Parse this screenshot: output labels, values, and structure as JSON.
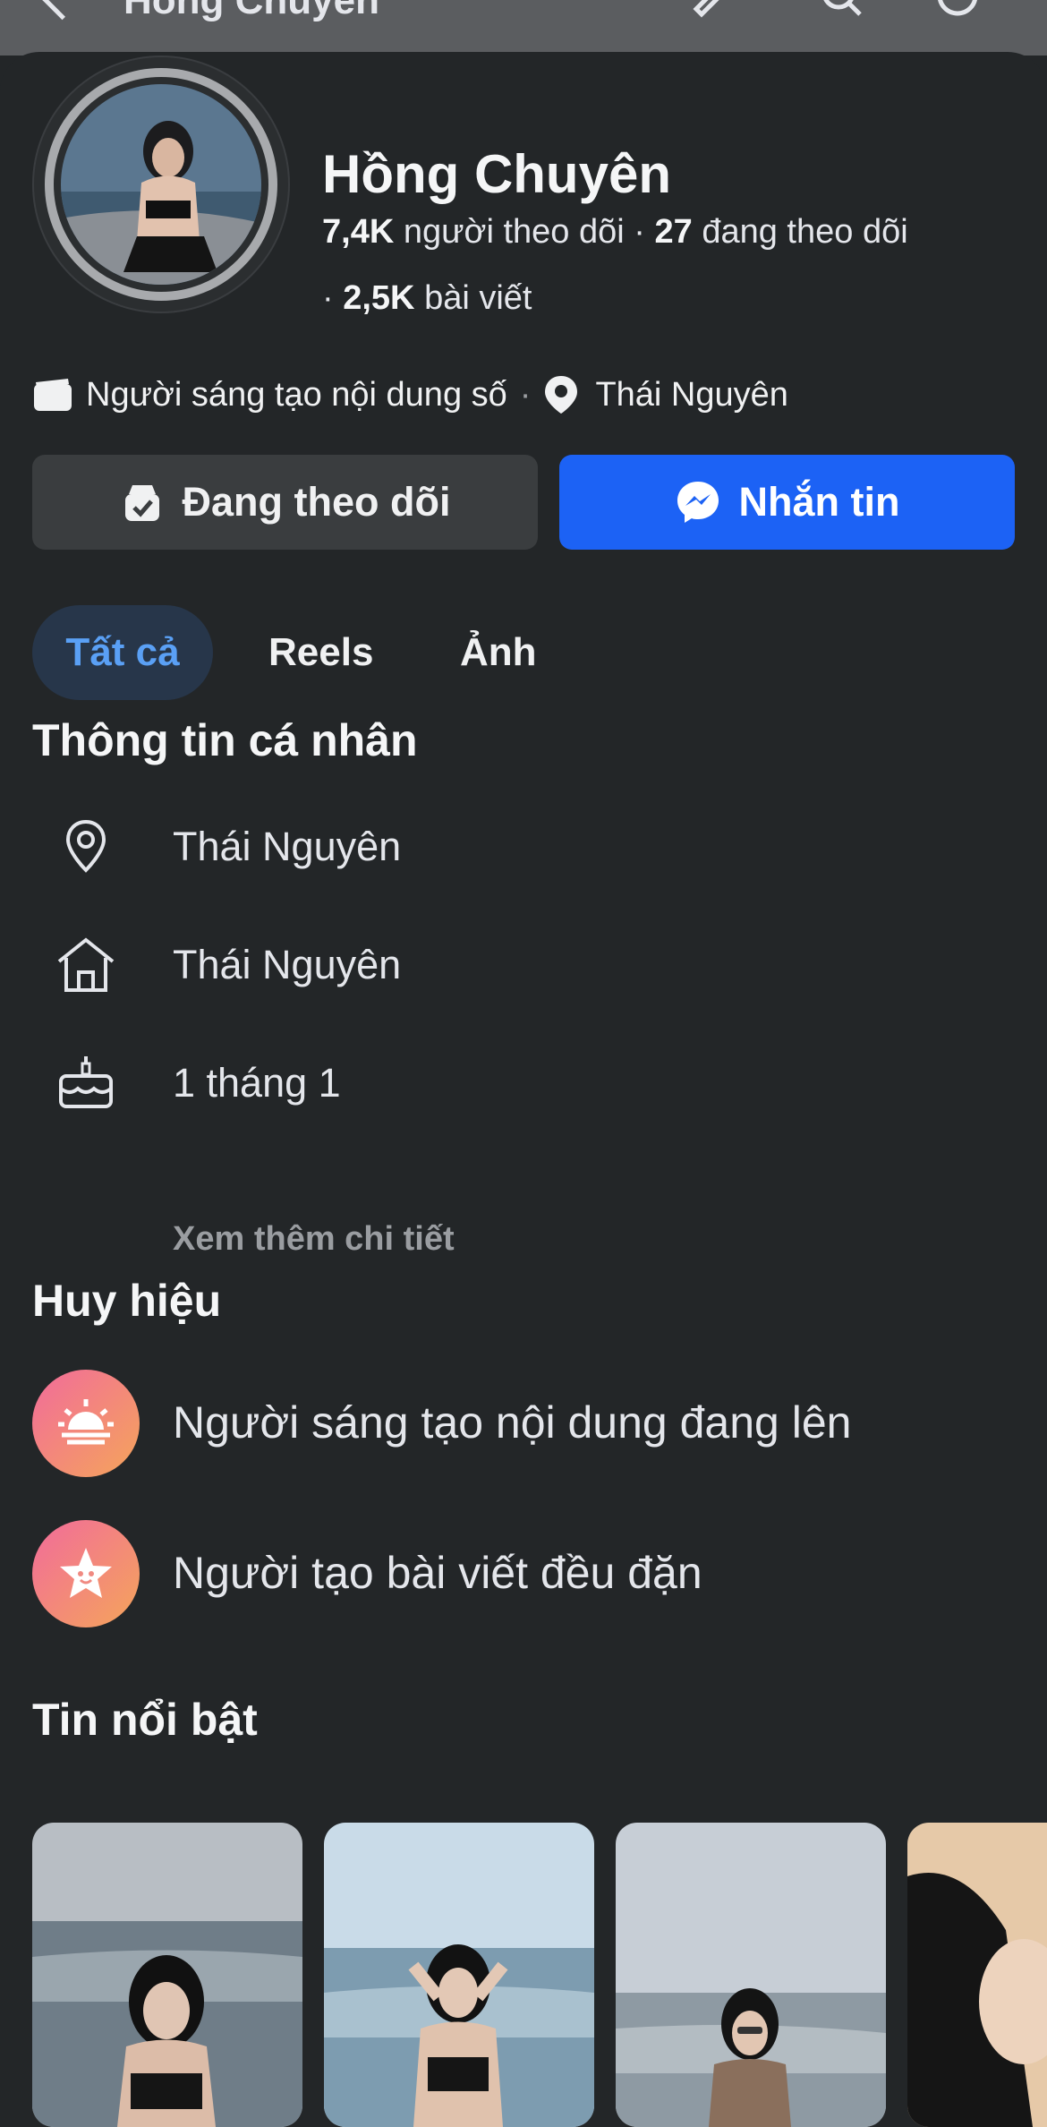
{
  "header": {
    "title": "Hồng Chuyên"
  },
  "profile": {
    "name": "Hồng Chuyên",
    "followers_count": "7,4K",
    "followers_label": "người theo dõi",
    "following_count": "27",
    "following_label": "đang theo dõi",
    "posts_count": "2,5K",
    "posts_label": "bài viết",
    "category": "Người sáng tạo nội dung số",
    "location": "Thái Nguyên"
  },
  "actions": {
    "follow_label": "Đang theo dõi",
    "message_label": "Nhắn tin"
  },
  "tabs": [
    {
      "label": "Tất cả",
      "active": true
    },
    {
      "label": "Reels",
      "active": false
    },
    {
      "label": "Ảnh",
      "active": false
    }
  ],
  "about": {
    "title": "Thông tin cá nhân",
    "items": [
      {
        "icon": "location-pin-icon",
        "text": "Thái Nguyên"
      },
      {
        "icon": "home-icon",
        "text": "Thái Nguyên"
      },
      {
        "icon": "birthday-cake-icon",
        "text": "1 tháng 1"
      }
    ],
    "see_more": "Xem thêm chi tiết"
  },
  "badges": {
    "title": "Huy hiệu",
    "items": [
      {
        "icon": "sunrise-icon",
        "text": "Người sáng tạo nội dung đang lên"
      },
      {
        "icon": "star-icon",
        "text": "Người tạo bài viết đều đặn"
      }
    ]
  },
  "highlights": {
    "title": "Tin nổi bật"
  },
  "colors": {
    "accent": "#1c62f5",
    "background": "#232628",
    "active_tab_text": "#5aa0f5"
  }
}
